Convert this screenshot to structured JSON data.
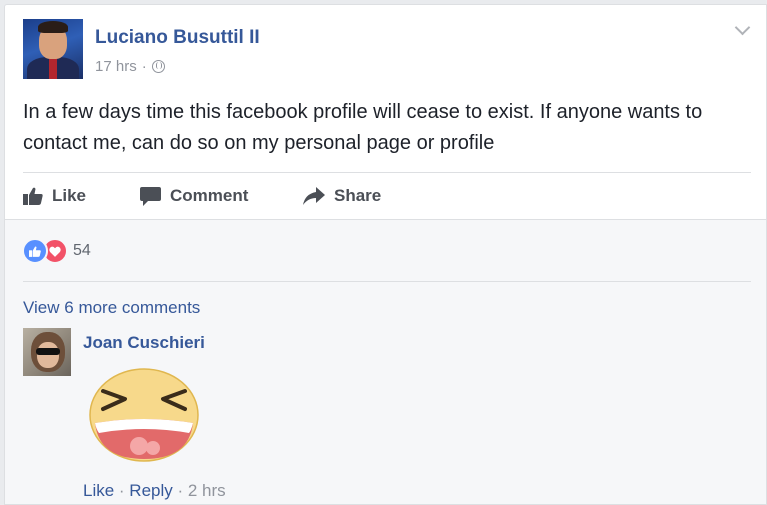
{
  "post": {
    "author": "Luciano Busuttil II",
    "time": "17 hrs",
    "separator": "·",
    "privacy_icon": "globe-icon",
    "menu_icon": "chevron-down-icon",
    "text": "In a few days time this facebook profile will cease to exist. If anyone wants to contact me, can do so on my personal page or profile"
  },
  "actions": {
    "like_label": "Like",
    "comment_label": "Comment",
    "share_label": "Share"
  },
  "reactions": {
    "types": [
      "like",
      "love"
    ],
    "count": "54"
  },
  "comments": {
    "view_more": "View 6 more comments",
    "items": [
      {
        "author": "Joan Cuschieri",
        "sticker": "laughing-sticker",
        "like_label": "Like",
        "reply_label": "Reply",
        "time": "2 hrs",
        "separator": " · "
      }
    ]
  },
  "colors": {
    "link_blue": "#365899",
    "meta_gray": "#90949c",
    "like_blue": "#5890ff",
    "love_red": "#f25268"
  }
}
